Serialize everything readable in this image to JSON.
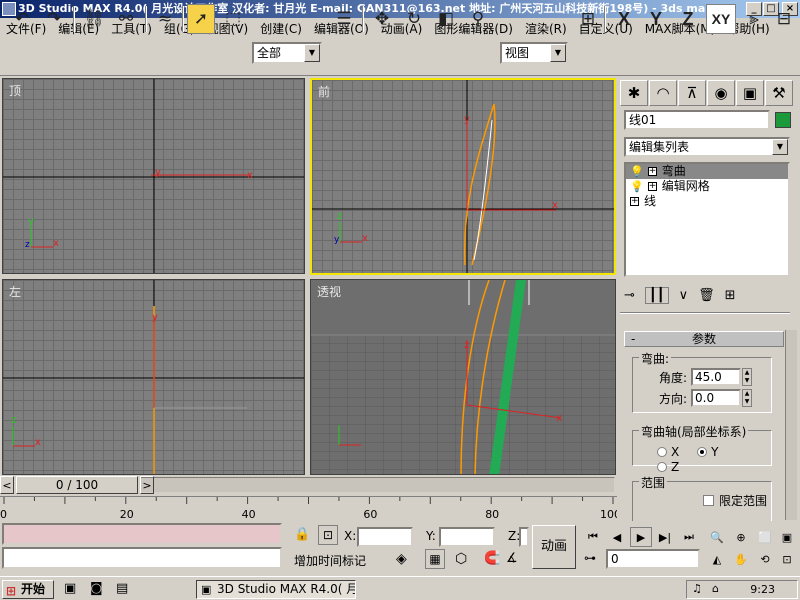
{
  "window": {
    "title": "3D Studio MAX R4.0( 月光设计工作室  汉化者: 甘月光  E-mail: GAN311@163.net  地址: 广州天河五山科技新街198号) - 3ds ma...",
    "min": "_",
    "max": "□",
    "close": "×"
  },
  "menu": [
    "文件(F)",
    "编辑(E)",
    "工具(T)",
    "组(G)",
    "视图(V)",
    "创建(C)",
    "编辑器(O)",
    "动画(A)",
    "图形编辑器(D)",
    "渲染(R)",
    "自定义(U)",
    "MAX脚本(M)",
    "帮助(H)"
  ],
  "toolbar": {
    "selection_filter": "全部",
    "ref_coord": "视图",
    "axis_x": "X",
    "axis_y": "Y",
    "axis_z": "Z",
    "axis_xy": "XY"
  },
  "viewports": {
    "top": "顶",
    "front": "前",
    "left": "左",
    "perspective": "透视"
  },
  "command_panel": {
    "object_name": "线01",
    "object_color": "#1a9a3a",
    "modifier_list": "编辑集列表",
    "stack": [
      {
        "label": "弯曲",
        "selected": true
      },
      {
        "label": "编辑网格",
        "selected": false
      },
      {
        "label": "线",
        "selected": false
      }
    ],
    "params": {
      "title": "参数",
      "bend_group": "弯曲:",
      "angle_label": "角度:",
      "angle_value": "45.0",
      "direction_label": "方向:",
      "direction_value": "0.0",
      "axis_group": "弯曲轴(局部坐标系)",
      "axis_x": "X",
      "axis_y": "Y",
      "axis_z": "Z",
      "axis_selected": "Y",
      "limits_group": "范围",
      "limit_label": "限定范围",
      "rollout_minus": "-"
    }
  },
  "timeline": {
    "frame": "0 / 100",
    "prev": "<",
    "next": ">"
  },
  "ruler": {
    "ticks": [
      "0",
      "20",
      "40",
      "60",
      "80",
      "100"
    ]
  },
  "status": {
    "x_label": "X:",
    "y_label": "Y:",
    "z_label": "Z:",
    "x_value": "",
    "y_value": "",
    "z_value": "",
    "add_time_tag": "增加时间标记",
    "animate": "动画",
    "frame_value": "0"
  },
  "taskbar": {
    "start": "开始",
    "task": "3D Studio MAX R4.0( 月...",
    "time": "9:23"
  }
}
